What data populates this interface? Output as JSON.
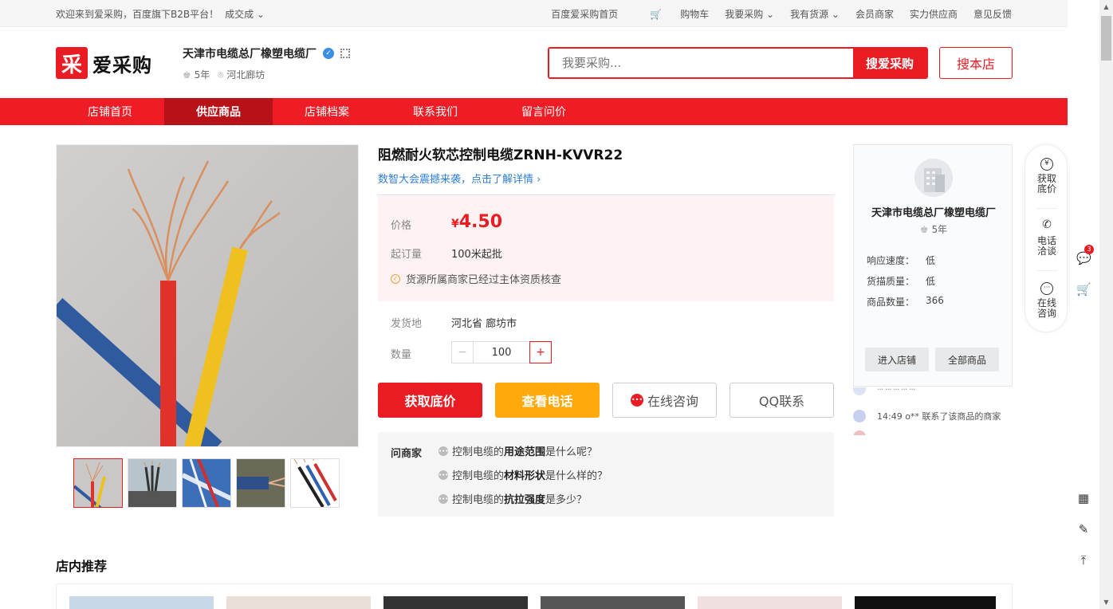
{
  "topbar": {
    "welcome": "欢迎来到爱采购，百度旗下B2B平台！",
    "change": "成交成 ⌄",
    "links": [
      "百度爱采购首页",
      "购物车",
      "我要采购 ⌄",
      "我有货源 ⌄",
      "会员商家",
      "实力供应商",
      "意见反馈"
    ]
  },
  "header": {
    "logo_mark": "采",
    "logo_text": "爱采购",
    "shop_name": "天津市电缆总厂橡塑电缆厂",
    "shop_years": "5年",
    "shop_location": "河北廊坊",
    "search_placeholder": "我要采购...",
    "search_button": "搜爱采购",
    "shop_search_button": "搜本店"
  },
  "nav": [
    "店铺首页",
    "供应商品",
    "店铺档案",
    "联系我们",
    "留言问价"
  ],
  "product": {
    "title": "阻燃耐火软芯控制电缆ZRNH-KVVR22",
    "promo": "数智大会震撼来袭，点击了解详情 ›",
    "price_label": "价格",
    "currency": "¥",
    "price": "4.50",
    "moq_label": "起订量",
    "moq": "100米起批",
    "verified": "货源所属商家已经过主体资质核查",
    "ship_label": "发货地",
    "ship_from": "河北省 廊坊市",
    "qty_label": "数量",
    "qty": "100",
    "buttons": {
      "lowest_price": "获取底价",
      "view_phone": "查看电话",
      "online_chat": "在线咨询",
      "qq": "QQ联系"
    },
    "ask": {
      "label": "问商家",
      "items": [
        {
          "pre": "控制电缆的",
          "key": "用途范围",
          "post": "是什么呢？"
        },
        {
          "pre": "控制电缆的",
          "key": "材料形状",
          "post": "是什么样的？"
        },
        {
          "pre": "控制电缆的",
          "key": "抗拉强度",
          "post": "是多少？"
        }
      ]
    }
  },
  "store_card": {
    "name": "天津市电缆总厂橡塑电缆厂",
    "years": "5年",
    "stats": [
      {
        "label": "响应速度：",
        "value": "低"
      },
      {
        "label": "货描质量：",
        "value": "低"
      },
      {
        "label": "商品数量：",
        "value": "366"
      }
    ],
    "enter_button": "进入店铺",
    "all_button": "全部商品"
  },
  "feed": {
    "row": "14:49 o** 联系了该商品的商家"
  },
  "float_bar": {
    "items": [
      "获取\n底价",
      "电话\n洽谈",
      "在线\n咨询"
    ]
  },
  "side": {
    "badge": "3"
  },
  "recommend": {
    "title": "店内推荐"
  },
  "colors": {
    "brand_red": "#e81c22",
    "nav_red": "#ee1c24",
    "orange": "#ffa90b",
    "link_blue": "#2e7ed6"
  }
}
